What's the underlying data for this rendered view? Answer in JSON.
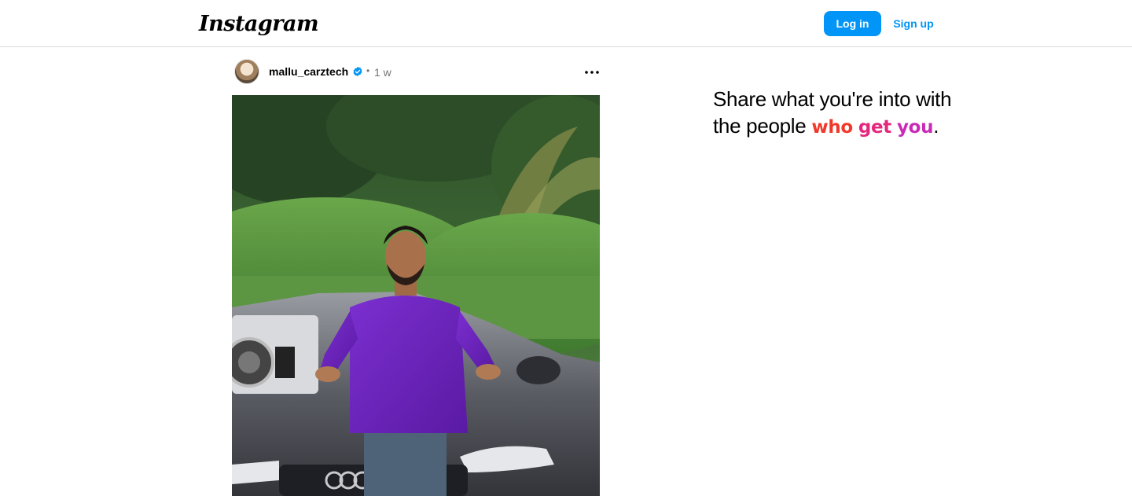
{
  "nav": {
    "logo": "Instagram",
    "login_label": "Log in",
    "signup_label": "Sign up"
  },
  "post": {
    "username": "mallu_carztech",
    "verified": true,
    "separator": "•",
    "time": "1 w",
    "media_alt": "Man in purple shirt standing in front of a grey Audi car with audio equipment, green trees behind"
  },
  "tagline": {
    "line1": "Share what you're into with",
    "line2_prefix": "the people ",
    "highlight_1": "who",
    "highlight_2": "get",
    "highlight_3": "you",
    "suffix": "."
  },
  "colors": {
    "accent": "#0095f6",
    "border": "#dbdbdb",
    "muted_text": "#737373",
    "gradient_start": "#f0382b",
    "gradient_mid": "#e4267d",
    "gradient_end": "#c92bb7"
  },
  "icons": {
    "verified": "verified-badge-icon",
    "more": "more-options-icon"
  }
}
